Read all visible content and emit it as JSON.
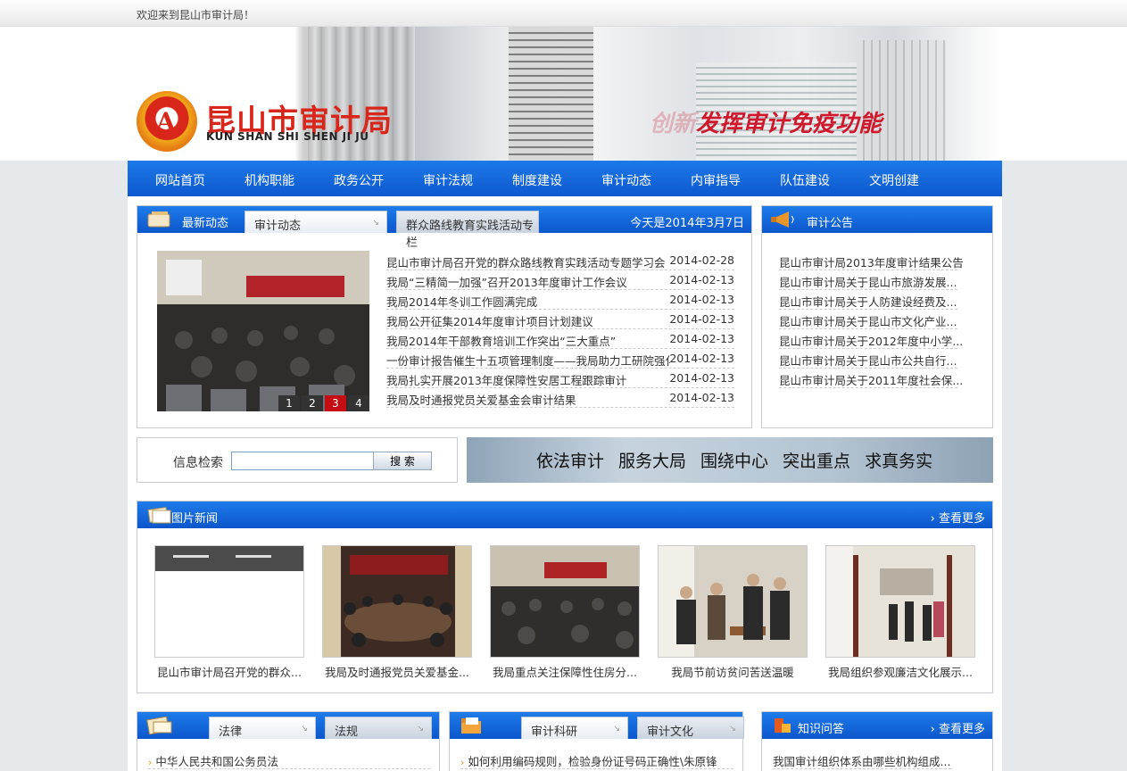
{
  "topbar": {
    "welcome": "欢迎来到昆山市审计局！"
  },
  "header": {
    "logo_cn": "昆山市审计局",
    "logo_en": "KUN SHAN SHI SHEN JI JU",
    "logo_mark": "A",
    "slogan_ghost": "创新",
    "slogan": "发挥审计免疫功能",
    "brand_red": "#d8261b",
    "nav_blue": "#0e58cf"
  },
  "nav": {
    "items": [
      "网站首页",
      "机构职能",
      "政务公开",
      "审计法规",
      "制度建设",
      "审计动态",
      "内审指导",
      "队伍建设",
      "文明创建"
    ]
  },
  "news": {
    "title": "最新动态",
    "tab1": "审计动态",
    "tab2": "群众路线教育实践活动专栏",
    "today": "今天是2014年3月7日",
    "pages": [
      "1",
      "2",
      "3",
      "4"
    ],
    "items": [
      {
        "title": "昆山市审计局召开党的群众路线教育实践活动专题学习会",
        "date": "2014-02-28"
      },
      {
        "title": "我局“三精简一加强”召开2013年度审计工作会议",
        "date": "2014-02-13"
      },
      {
        "title": "我局2014年冬训工作圆满完成",
        "date": "2014-02-13"
      },
      {
        "title": "我局公开征集2014年度审计项目计划建议",
        "date": "2014-02-13"
      },
      {
        "title": "我局2014年干部教育培训工作突出“三大重点”",
        "date": "2014-02-13"
      },
      {
        "title": "一份审计报告催生十五项管理制度——我局助力工研院强化...",
        "date": "2014-02-13"
      },
      {
        "title": "我局扎实开展2013年度保障性安居工程跟踪审计",
        "date": "2014-02-13"
      },
      {
        "title": "我局及时通报党员关爱基金会审计结果",
        "date": "2014-02-13"
      }
    ]
  },
  "notice": {
    "title": "审计公告",
    "items": [
      "昆山市审计局2013年度审计结果公告",
      "昆山市审计局关于昆山市旅游发展...",
      "昆山市审计局关于人防建设经费及...",
      "昆山市审计局关于昆山市文化产业...",
      "昆山市审计局关于2012年度中小学...",
      "昆山市审计局关于昆山市公共自行...",
      "昆山市审计局关于2011年度社会保..."
    ]
  },
  "search": {
    "label": "信息检索",
    "button": "搜 索",
    "value": ""
  },
  "motto": {
    "items": [
      "依法审计",
      "服务大局",
      "围绕中心",
      "突出重点",
      "求真务实"
    ]
  },
  "photos": {
    "title": "图片新闻",
    "more": "查看更多",
    "items": [
      "昆山市审计局召开党的群众...",
      "我局及时通报党员关爱基金...",
      "我局重点关注保障性住房分...",
      "我局节前访贫问苦送温暖",
      "我局组织参观廉洁文化展示..."
    ]
  },
  "bottom": {
    "law_tab1": "法律",
    "law_tab2": "法规",
    "law_item": "中华人民共和国公务员法",
    "sci_tab1": "审计科研",
    "sci_tab2": "审计文化",
    "sci_item": "如何利用编码规则，检验身份证号码正确性\\朱原锋",
    "qa_title": "知识问答",
    "qa_more": "查看更多",
    "qa_item": "我国审计组织体系由哪些机构组成..."
  }
}
